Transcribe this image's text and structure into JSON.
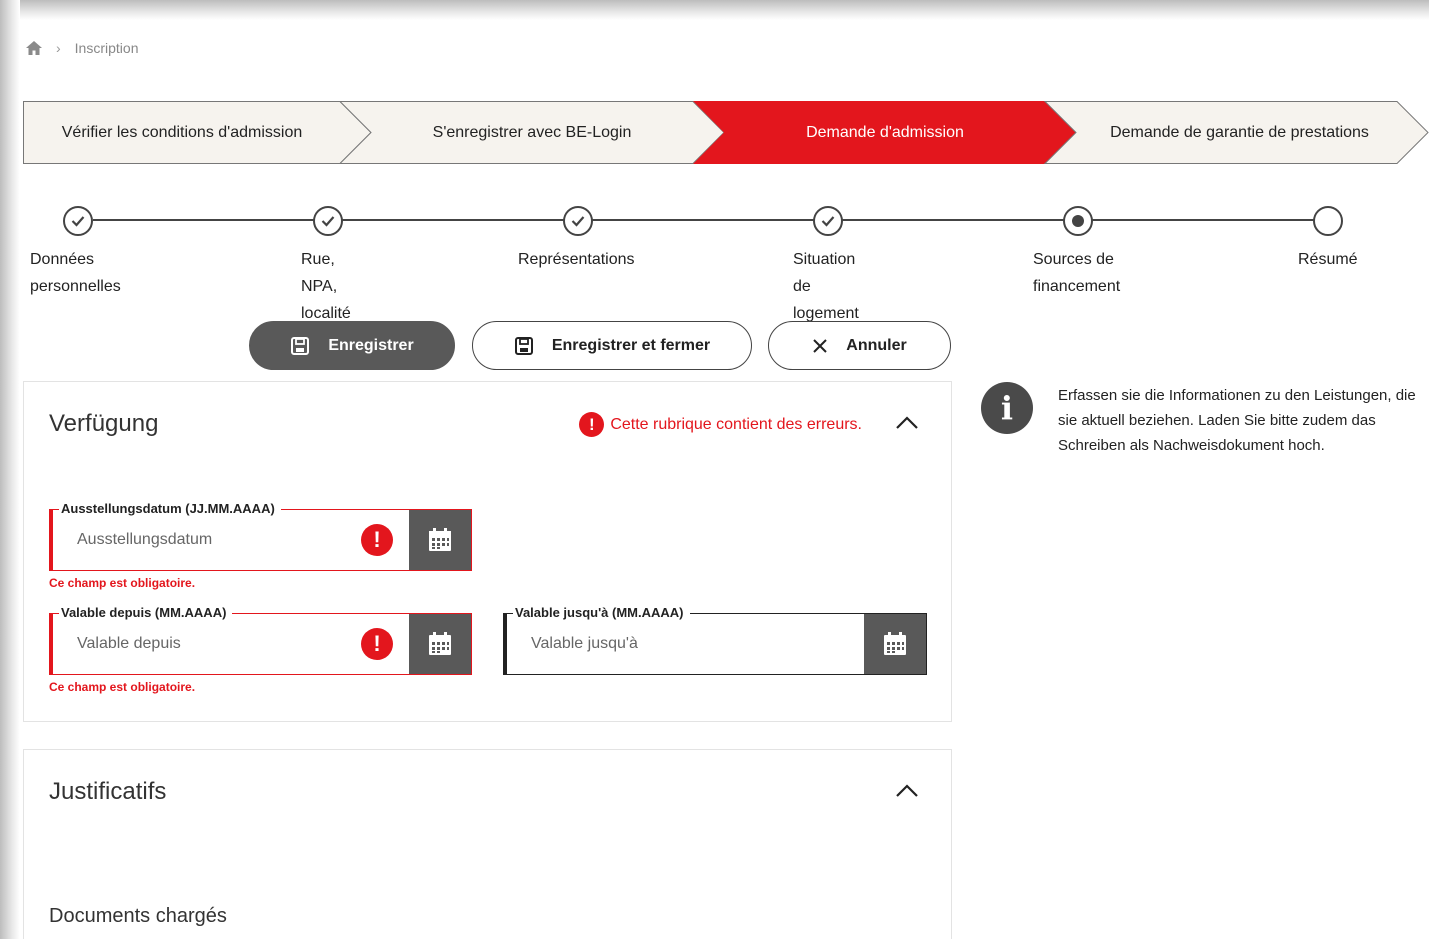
{
  "breadcrumb": {
    "home_icon": "home-icon",
    "current": "Inscription"
  },
  "process_steps": [
    {
      "label": "Vérifier les conditions d'admission",
      "state": "done"
    },
    {
      "label": "S'enregistrer avec BE-Login",
      "state": "done"
    },
    {
      "label": "Demande d'admission",
      "state": "active"
    },
    {
      "label": "Demande de garantie de prestations",
      "state": "todo"
    }
  ],
  "colors": {
    "accent_red": "#e3161d",
    "dark_gray": "#595959",
    "step_bg": "#f6f3ee"
  },
  "stepper": [
    {
      "lines": [
        "Données",
        "personnelles"
      ],
      "status": "completed"
    },
    {
      "lines": [
        "Rue,",
        "NPA,",
        "localité"
      ],
      "status": "completed"
    },
    {
      "lines": [
        "Représentations"
      ],
      "status": "completed"
    },
    {
      "lines": [
        "Situation",
        "de",
        "logement"
      ],
      "status": "completed"
    },
    {
      "lines": [
        "Sources de",
        "financement"
      ],
      "status": "current"
    },
    {
      "lines": [
        "Résumé"
      ],
      "status": "upcoming"
    }
  ],
  "actions": {
    "save": "Enregistrer",
    "save_close": "Enregistrer et fermer",
    "cancel": "Annuler"
  },
  "section_verfuegung": {
    "title": "Verfügung",
    "error_summary": "Cette rubrique contient des erreurs.",
    "fields": {
      "ausstellungsdatum": {
        "legend": "Ausstellungsdatum (JJ.MM.AAAA)",
        "placeholder": "Ausstellungsdatum",
        "value": "",
        "error": "Ce champ est obligatoire."
      },
      "valable_depuis": {
        "legend": "Valable depuis (MM.AAAA)",
        "placeholder": "Valable depuis",
        "value": "",
        "error": "Ce champ est obligatoire."
      },
      "valable_jusqua": {
        "legend": "Valable jusqu'à (MM.AAAA)",
        "placeholder": "Valable jusqu'à",
        "value": ""
      }
    }
  },
  "info_panel": {
    "text": "Erfassen sie die Informationen zu den Leistungen, die sie aktuell beziehen. Laden Sie bitte zudem das Schreiben als Nachweisdokument hoch."
  },
  "section_justificatifs": {
    "title": "Justificatifs",
    "subtitle": "Documents chargés"
  }
}
